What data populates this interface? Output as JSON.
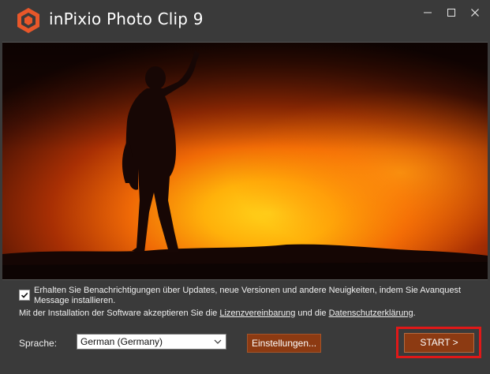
{
  "window": {
    "title": "inPixio Photo Clip 9",
    "logo_icon": "inpixio-logo-icon",
    "controls": {
      "minimize": "—",
      "maximize": "☐",
      "close": "✕"
    }
  },
  "hero": {
    "image": "silhouette-volcano-photo"
  },
  "consent": {
    "checked": true,
    "text": "Erhalten Sie Benachrichtigungen über Updates, neue Versionen und andere Neuigkeiten, indem Sie Avanquest Message installieren."
  },
  "license": {
    "prefix": "Mit der Installation der Software akzeptieren Sie die ",
    "link1": "Lizenzvereinbarung",
    "middle": " und die ",
    "link2": "Datenschutzerklärung",
    "suffix": "."
  },
  "language": {
    "label": "Sprache:",
    "selected": "German (Germany)"
  },
  "buttons": {
    "settings": "Einstellungen...",
    "start": "START >"
  },
  "colors": {
    "background": "#3a3a3a",
    "button": "#8c3a12",
    "highlight": "#e01818",
    "logo": "#e8572a"
  }
}
